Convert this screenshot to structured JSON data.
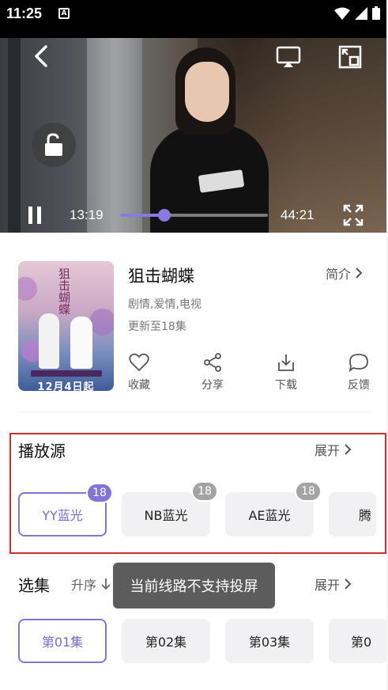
{
  "status_bar": {
    "time": "11:25",
    "notification_icon": "A"
  },
  "player": {
    "current_time": "13:19",
    "total_time": "44:21",
    "progress_percent": 30
  },
  "drama": {
    "title": "狙击蝴蝶",
    "intro_label": "简介",
    "tags": "剧情,爱情,电视",
    "update_status": "更新至18集",
    "poster": {
      "title_text": "狙击蝴蝶",
      "date_text": "12月4日起"
    }
  },
  "actions": [
    {
      "label": "收藏",
      "icon": "heart-icon"
    },
    {
      "label": "分享",
      "icon": "share-icon"
    },
    {
      "label": "下载",
      "icon": "download-icon"
    },
    {
      "label": "反馈",
      "icon": "feedback-icon"
    }
  ],
  "source": {
    "title": "播放源",
    "expand_label": "展开",
    "items": [
      {
        "label": "YY蓝光",
        "badge": "18",
        "active": true
      },
      {
        "label": "NB蓝光",
        "badge": "18",
        "active": false
      },
      {
        "label": "AE蓝光",
        "badge": "18",
        "active": false
      },
      {
        "label": "腾",
        "badge": "",
        "active": false
      }
    ]
  },
  "episodes": {
    "title": "选集",
    "sort_label": "升序",
    "expand_label": "展开",
    "items": [
      {
        "label": "第01集",
        "active": true
      },
      {
        "label": "第02集",
        "active": false
      },
      {
        "label": "第03集",
        "active": false
      },
      {
        "label": "第0",
        "active": false
      }
    ]
  },
  "toast": {
    "message": "当前线路不支持投屏"
  },
  "colors": {
    "accent": "#8474d8",
    "highlight_border": "#d12f2f"
  }
}
